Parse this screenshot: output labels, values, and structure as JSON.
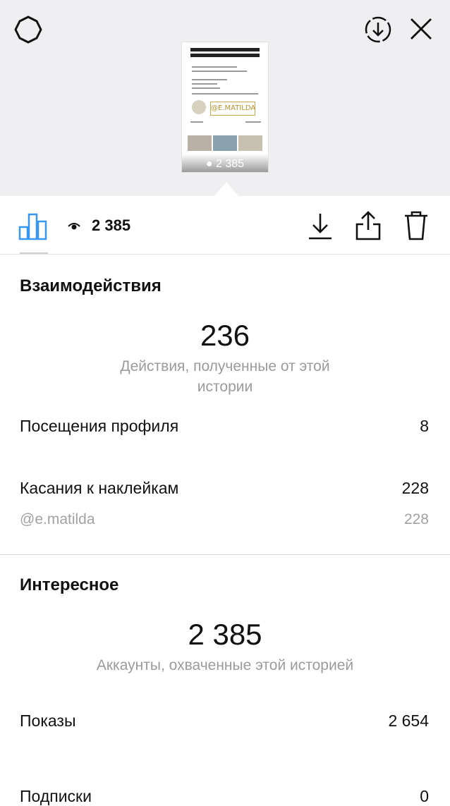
{
  "top_bar": {
    "settings_icon": "gear-icon",
    "save_icon": "download-circle-icon",
    "close_icon": "close-icon"
  },
  "story_preview": {
    "handle": "@E.MATILDA",
    "views": "2 385"
  },
  "toolbar": {
    "views_count": "2 385",
    "tabs": [
      "insights-icon"
    ],
    "actions": [
      "download-icon",
      "share-icon",
      "delete-icon"
    ],
    "accent_color": "#3897f0"
  },
  "interactions": {
    "title": "Взаимодействия",
    "total": "236",
    "caption": "Действия, полученные от этой истории",
    "rows": [
      {
        "label": "Посещения профиля",
        "value": "8"
      },
      {
        "label": "Касания к наклейкам",
        "value": "228"
      }
    ],
    "sub_rows": [
      {
        "label": "@e.matilda",
        "value": "228"
      }
    ]
  },
  "discovery": {
    "title": "Интересное",
    "total": "2 385",
    "caption": "Аккаунты, охваченные этой историей",
    "rows": [
      {
        "label": "Показы",
        "value": "2 654"
      },
      {
        "label": "Подписки",
        "value": "0"
      }
    ]
  }
}
